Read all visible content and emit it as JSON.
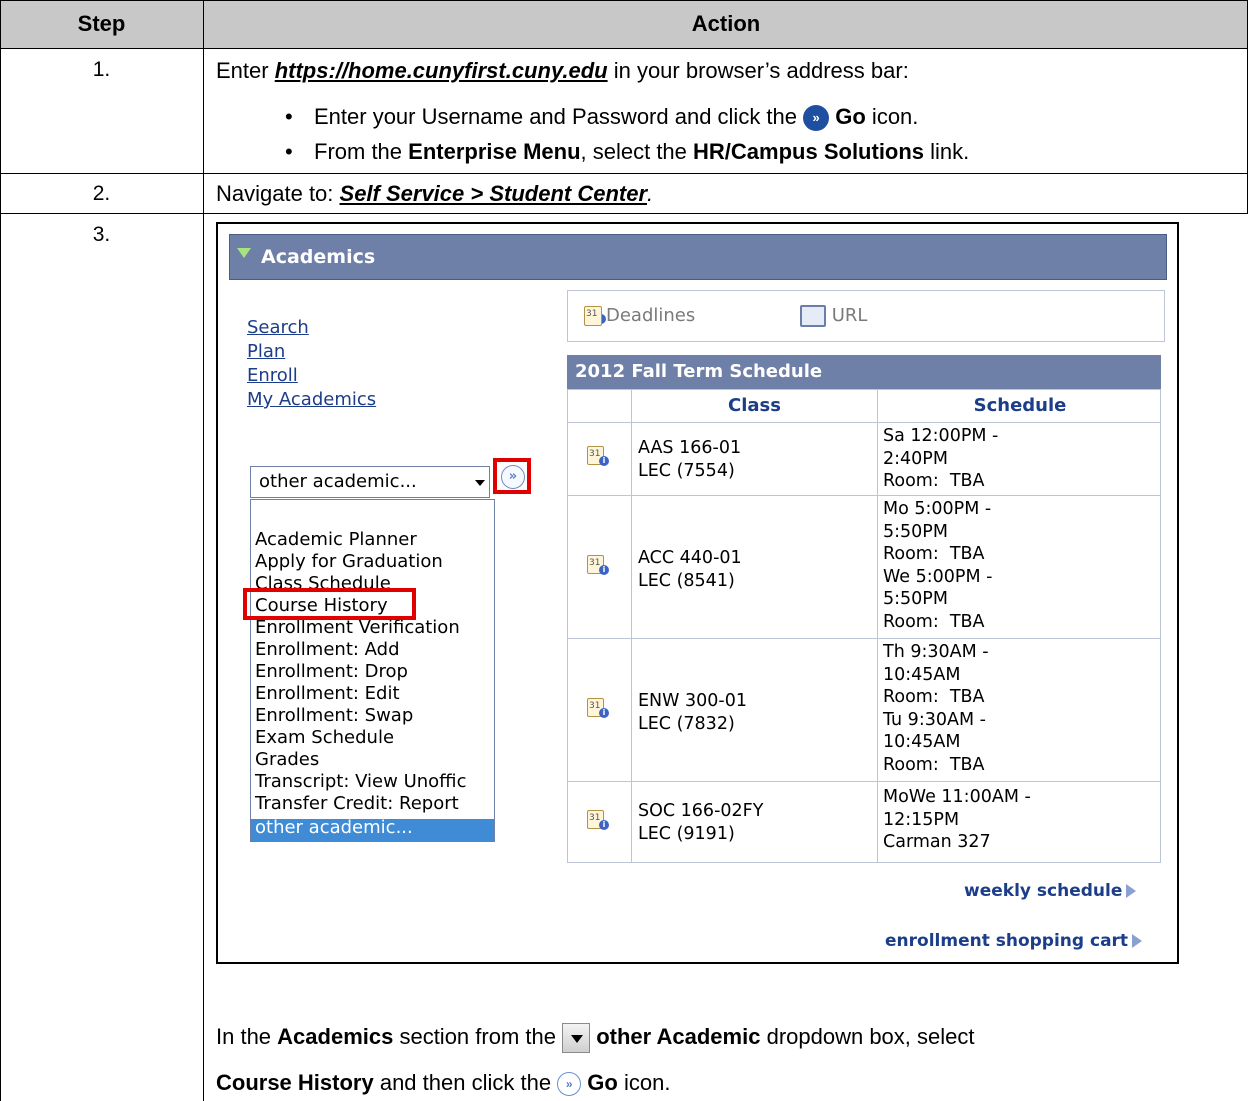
{
  "table": {
    "col_step": "Step",
    "col_action": "Action"
  },
  "row1": {
    "step": "1.",
    "pre": "Enter ",
    "url": "https://home.cunyfirst.cuny.edu",
    "post": " in your browser’s address bar:",
    "bullet1_pre": "Enter your Username and Password and click the ",
    "bullet1_bold": "Go",
    "bullet1_post": " icon.",
    "bullet2_pre": "From the ",
    "bullet2_b1": "Enterprise Menu",
    "bullet2_mid": ", select the ",
    "bullet2_b2": "HR/Campus Solutions",
    "bullet2_post": " link."
  },
  "row2": {
    "step": "2.",
    "pre": "Navigate to:  ",
    "path": "Self Service > Student Center",
    "post": "."
  },
  "row3": {
    "step": "3.",
    "line1_pre": "In the ",
    "line1_b1": "Academics",
    "line1_mid": " section from the ",
    "line1_b2": "other Academic",
    "line1_post": " dropdown box, select",
    "line2_b1": "Course History",
    "line2_mid": " and then click the ",
    "line2_b2": "Go",
    "line2_post": " icon."
  },
  "shot": {
    "section_title": "Academics",
    "nav": [
      "Search",
      "Plan",
      "Enroll",
      "My Academics"
    ],
    "select_value": "other academic...",
    "go_glyph": "»",
    "dropdown_options": [
      "Academic Planner",
      "Apply for Graduation",
      "Class Schedule",
      "Course History",
      "Enrollment Verification",
      "Enrollment: Add",
      "Enrollment: Drop",
      "Enrollment: Edit",
      "Enrollment: Swap",
      "Exam Schedule",
      "Grades",
      "Transcript: View Unoffic",
      "Transfer Credit: Report",
      "other academic..."
    ],
    "toolbar": {
      "deadlines": "Deadlines",
      "url": "URL"
    },
    "term_title": "2012 Fall Term Schedule",
    "col_class": "Class",
    "col_schedule": "Schedule",
    "rows": [
      {
        "cls": "AAS 166-01\nLEC (7554)",
        "sched": "Sa 12:00PM -\n2:40PM\nRoom:  TBA"
      },
      {
        "cls": "ACC 440-01\nLEC (8541)",
        "sched": "Mo 5:00PM -\n5:50PM\nRoom:  TBA\nWe 5:00PM -\n5:50PM\nRoom:  TBA"
      },
      {
        "cls": "ENW 300-01\nLEC (7832)",
        "sched": "Th 9:30AM -\n10:45AM\nRoom:  TBA\nTu 9:30AM -\n10:45AM\nRoom:  TBA"
      },
      {
        "cls": "SOC 166-02FY\nLEC (9191)",
        "sched": "MoWe 11:00AM -\n12:15PM\nCarman 327"
      }
    ],
    "weekly_link": "weekly schedule",
    "cart_link": "enrollment shopping cart"
  },
  "colors": {
    "header_gray": "#c8c8c8",
    "banner": "#6e7fa8",
    "highlight": "#e00000",
    "link": "#1c3d8a"
  }
}
